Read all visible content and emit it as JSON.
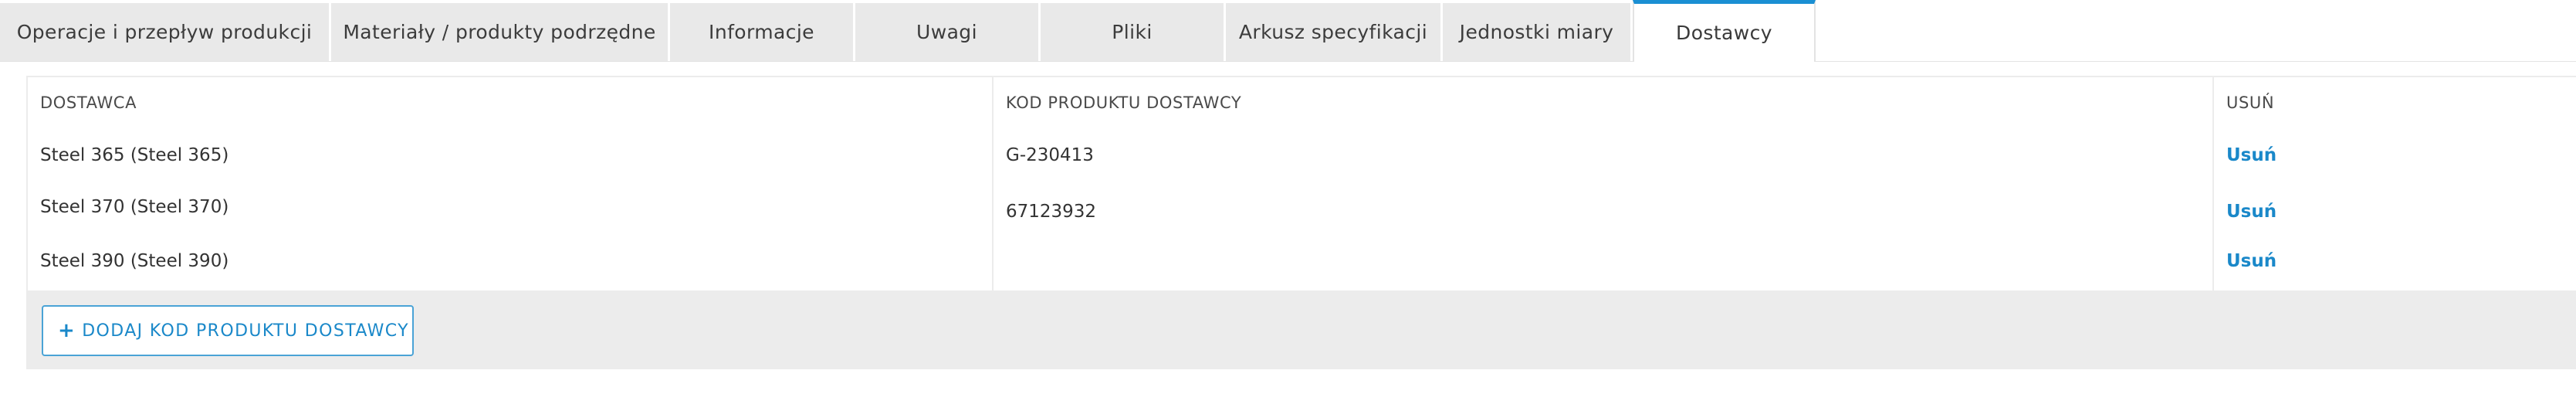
{
  "tabs": [
    {
      "label": "Operacje i przepływ produkcji"
    },
    {
      "label": "Materiały / produkty podrzędne"
    },
    {
      "label": "Informacje"
    },
    {
      "label": "Uwagi"
    },
    {
      "label": "Pliki"
    },
    {
      "label": "Arkusz specyfikacji"
    },
    {
      "label": "Jednostki miary"
    },
    {
      "label": "Dostawcy",
      "active": true
    }
  ],
  "table": {
    "headers": {
      "supplier": "DOSTAWCA",
      "code": "KOD PRODUKTU DOSTAWCY",
      "remove": "USUŃ"
    },
    "rows": [
      {
        "supplier": "Steel 365 (Steel 365)",
        "code": "G-230413",
        "remove": "Usuń"
      },
      {
        "supplier": "Steel 370 (Steel 370)",
        "code": "67123932",
        "remove": "Usuń"
      },
      {
        "supplier": "Steel 390 (Steel 390)",
        "code": "",
        "remove": "Usuń"
      }
    ]
  },
  "add_button": {
    "icon": "plus-icon",
    "label": "DODAJ KOD PRODUKTU DOSTAWCY"
  },
  "colors": {
    "accent": "#1a8fd3",
    "tab_bg": "#e9e9e9",
    "footer_bg": "#ececec"
  }
}
